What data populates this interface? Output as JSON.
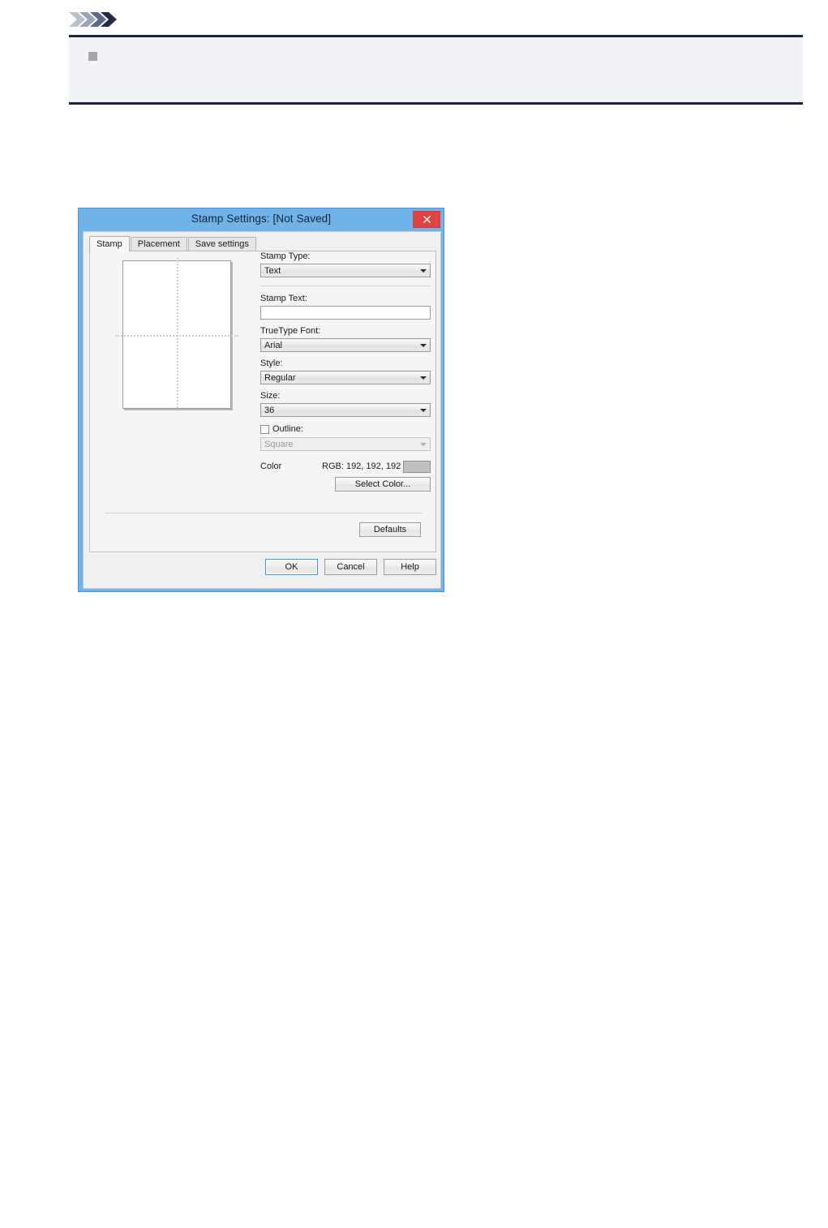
{
  "page": {
    "logo_icon": "chevron-logo",
    "note": {
      "bullet_icon": "square-bullet",
      "text": ""
    }
  },
  "dialog": {
    "title": "Stamp Settings: [Not Saved]",
    "close_label": "×",
    "close_icon": "close-icon",
    "tabs": [
      {
        "label": "Stamp",
        "active": true
      },
      {
        "label": "Placement",
        "active": false
      },
      {
        "label": "Save settings",
        "active": false
      }
    ],
    "preview": {
      "name": "stamp-preview",
      "guides": "dotted-crosshair"
    },
    "fields": {
      "stamp_type_label": "Stamp Type:",
      "stamp_type_value": "Text",
      "stamp_text_label": "Stamp Text:",
      "stamp_text_value": "",
      "stamp_text_placeholder": "",
      "truetype_font_label": "TrueType Font:",
      "truetype_font_value": "Arial",
      "style_label": "Style:",
      "style_value": "Regular",
      "size_label": "Size:",
      "size_value": "36",
      "outline_label": "Outline:",
      "outline_checked": false,
      "outline_value": "Square",
      "color_label": "Color",
      "color_rgb_text": "RGB: 192, 192, 192",
      "color_swatch_hex": "#c0c0c0",
      "select_color_label": "Select Color..."
    },
    "buttons": {
      "defaults": "Defaults",
      "ok": "OK",
      "cancel": "Cancel",
      "help": "Help"
    }
  },
  "colors": {
    "titlebar": "#6fb3e8",
    "note_bg": "#f1f3f9",
    "note_border": "#1b2344",
    "close_red": "#e04343",
    "accent_blue": "#3f9bd8"
  }
}
